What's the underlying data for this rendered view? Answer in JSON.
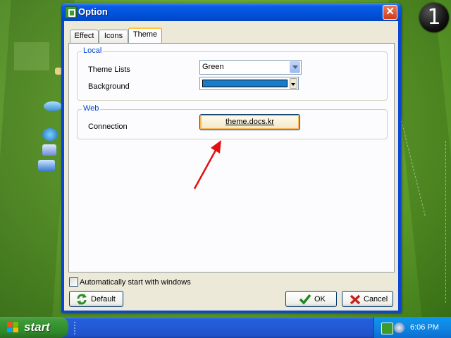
{
  "desktop": {
    "step_number": "1"
  },
  "window": {
    "title": "Option",
    "close_glyph": "✕",
    "tabs": [
      {
        "label": "Effect"
      },
      {
        "label": "Icons"
      },
      {
        "label": "Theme",
        "active": true
      }
    ],
    "local_group": {
      "title": "Local",
      "theme_lists_label": "Theme Lists",
      "theme_lists_value": "Green",
      "background_label": "Background",
      "background_color": "#1a7bc8"
    },
    "web_group": {
      "title": "Web",
      "connection_label": "Connection",
      "connection_link": "theme.docs.kr"
    },
    "autostart_label": "Automatically start with windows",
    "autostart_checked": false,
    "default_button": "Default",
    "ok_button": "OK",
    "cancel_button": "Cancel"
  },
  "taskbar": {
    "start_label": "start",
    "clock": "6:06 PM"
  },
  "colors": {
    "annotation_arrow": "#e01010",
    "group_title": "#0046d5"
  },
  "icons": {
    "title": "app-icon",
    "close": "close-icon",
    "default": "refresh-icon",
    "ok": "checkmark-icon",
    "cancel": "x-icon"
  }
}
